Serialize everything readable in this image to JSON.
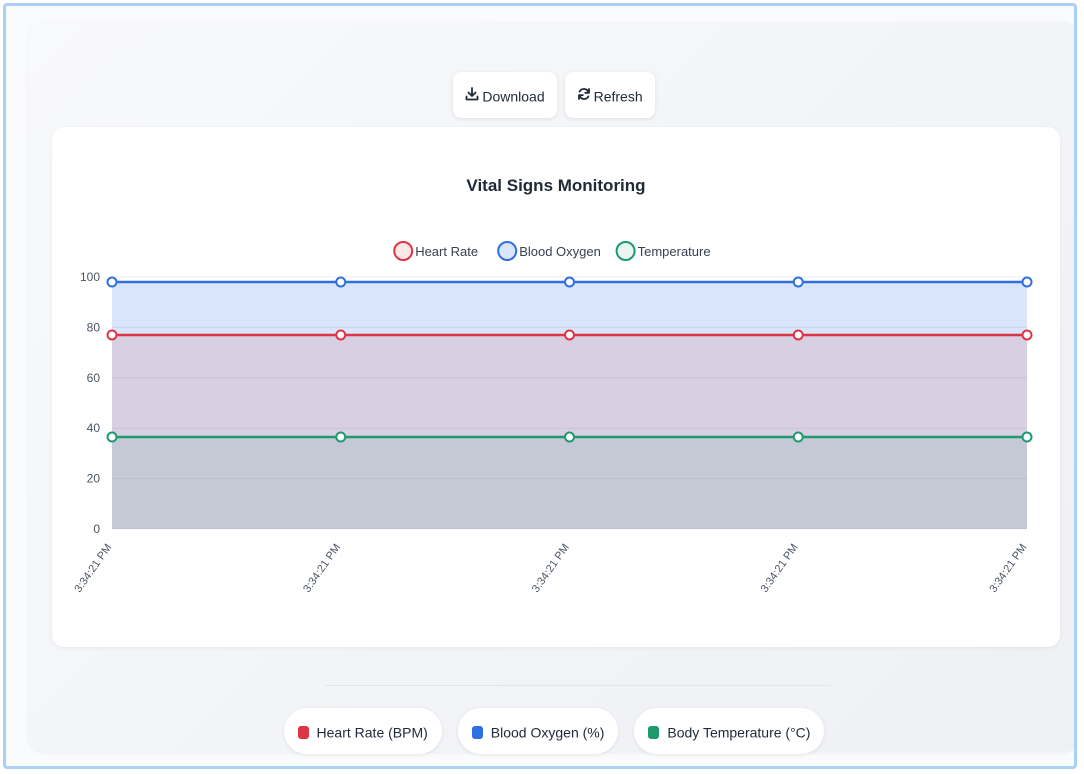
{
  "toolbar": {
    "download_label": "Download",
    "refresh_label": "Refresh"
  },
  "bottom_legend": [
    {
      "label": "Heart Rate (BPM)",
      "color": "#dc3545"
    },
    {
      "label": "Blood Oxygen (%)",
      "color": "#2f6fe4"
    },
    {
      "label": "Body Temperature (°C)",
      "color": "#1e9a6d"
    }
  ],
  "chart_data": {
    "type": "area",
    "title": "Vital Signs Monitoring",
    "xlabel": "",
    "ylabel": "",
    "ylim": [
      0,
      100
    ],
    "yticks": [
      0,
      20,
      40,
      60,
      80,
      100
    ],
    "categories": [
      "3:34:21 PM",
      "3:34:21 PM",
      "3:34:21 PM",
      "3:34:21 PM",
      "3:34:21 PM"
    ],
    "grid": "horizontal",
    "legend_position": "top",
    "series": [
      {
        "name": "Heart Rate",
        "values": [
          77,
          77,
          77,
          77,
          77
        ],
        "color": "#dc3545",
        "fill": "rgba(220,53,69,0.12)"
      },
      {
        "name": "Blood Oxygen",
        "values": [
          98,
          98,
          98,
          98,
          98
        ],
        "color": "#2f6fe4",
        "fill": "rgba(47,111,228,0.18)"
      },
      {
        "name": "Temperature",
        "values": [
          36.5,
          36.5,
          36.5,
          36.5,
          36.5
        ],
        "color": "#1e9a6d",
        "fill": "rgba(30,154,109,0.10)"
      }
    ]
  }
}
